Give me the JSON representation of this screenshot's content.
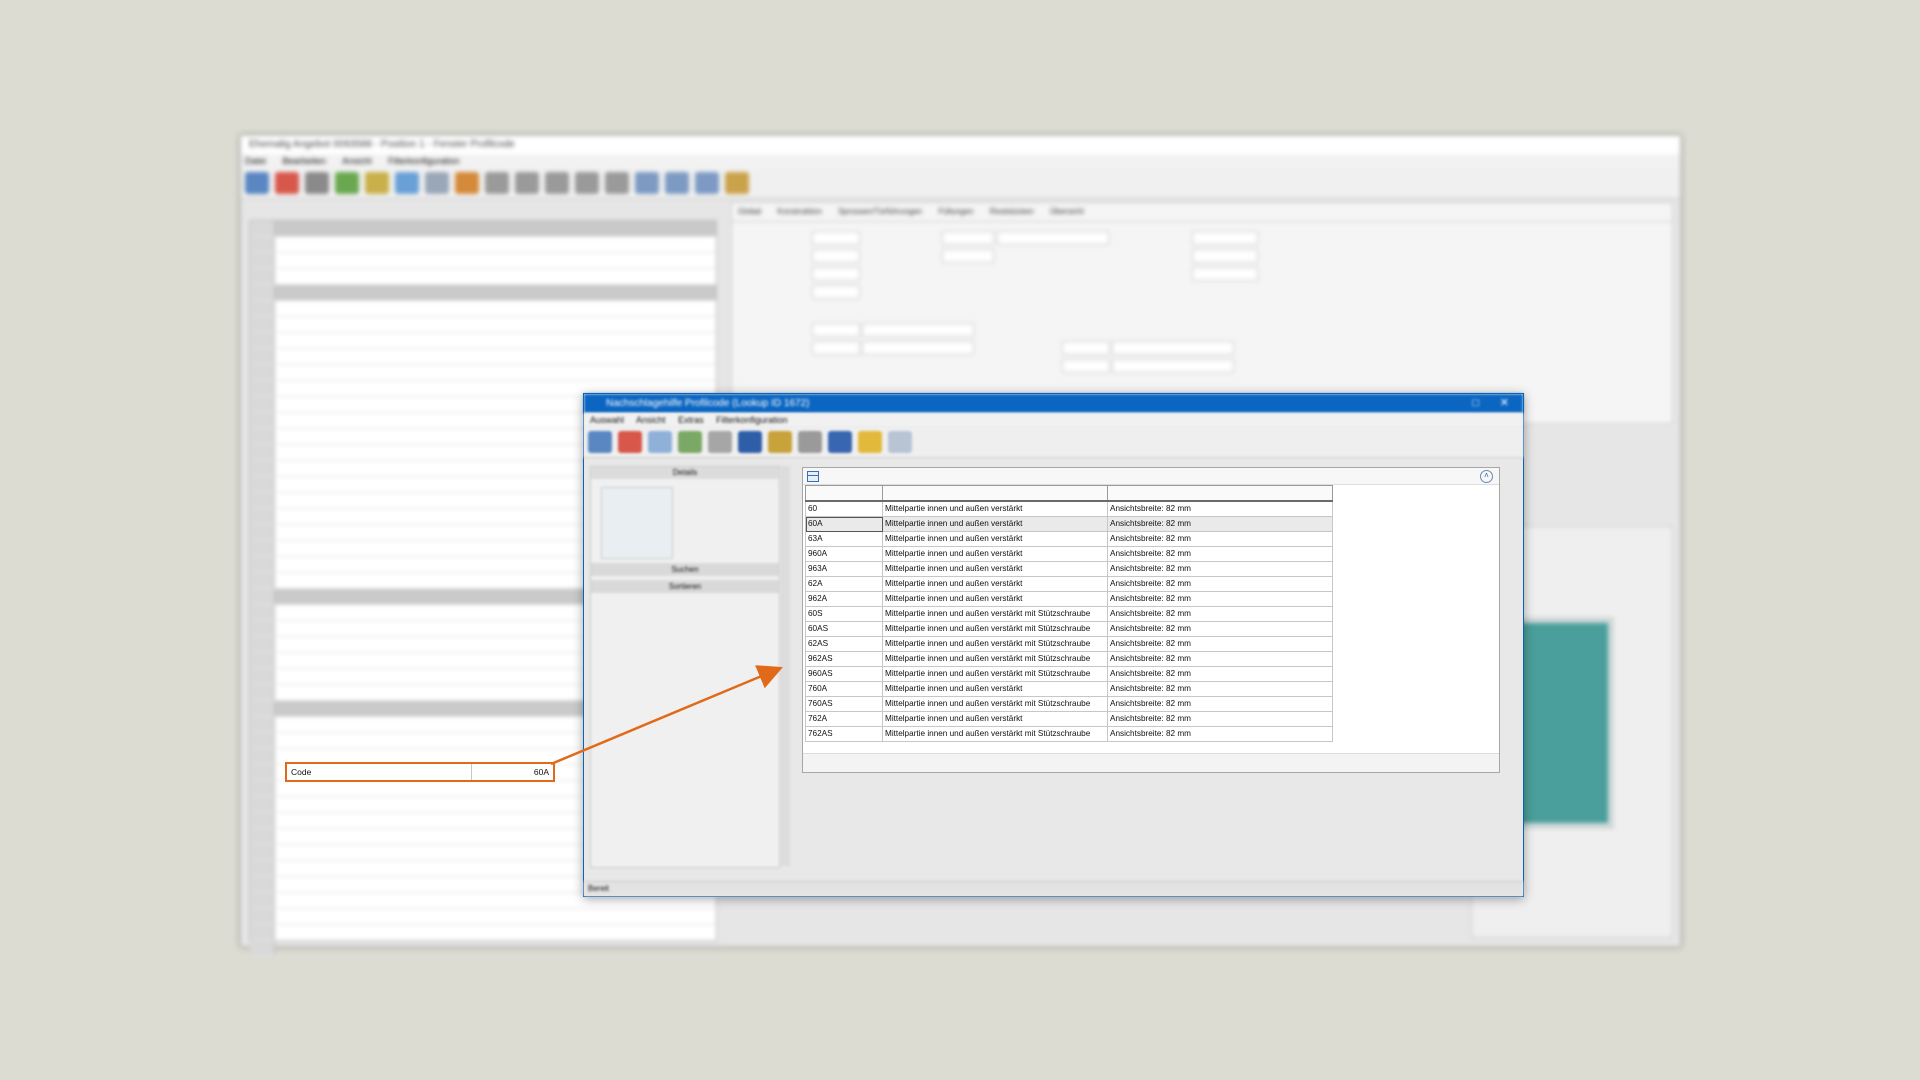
{
  "background_app": {
    "title": "Ehemalig Angebot 0093588 - Position 1 - Fenster Profilcode",
    "menu": [
      "Datei",
      "Bearbeiten",
      "Ansicht",
      "Filterkonfiguration"
    ],
    "tabs": [
      "Global",
      "Konstruktion",
      "Sprossen/Türführungen",
      "Füllungen",
      "Reststücken",
      "Übersicht"
    ]
  },
  "dialog": {
    "title": "Nachschlagehilfe Profilcode (Lookup ID 1672)",
    "menu": [
      "Auswahl",
      "Ansicht",
      "Extras",
      "Filterkonfiguration"
    ],
    "left_header": "Details",
    "actions": [
      "Suchen",
      "Sortieren"
    ],
    "status_left": "Bereit"
  },
  "lookup": {
    "columns": [
      "",
      "",
      ""
    ],
    "rows": [
      {
        "code": "60",
        "description": "Mittelpartie innen und außen verstärkt",
        "info": "Ansichtsbreite: 82 mm"
      },
      {
        "code": "60A",
        "description": "Mittelpartie innen und außen verstärkt",
        "info": "Ansichtsbreite: 82 mm"
      },
      {
        "code": "63A",
        "description": "Mittelpartie innen und außen verstärkt",
        "info": "Ansichtsbreite: 82 mm"
      },
      {
        "code": "960A",
        "description": "Mittelpartie innen und außen verstärkt",
        "info": "Ansichtsbreite: 82 mm"
      },
      {
        "code": "963A",
        "description": "Mittelpartie innen und außen verstärkt",
        "info": "Ansichtsbreite: 82 mm"
      },
      {
        "code": "62A",
        "description": "Mittelpartie innen und außen verstärkt",
        "info": "Ansichtsbreite: 82 mm"
      },
      {
        "code": "962A",
        "description": "Mittelpartie innen und außen verstärkt",
        "info": "Ansichtsbreite: 82 mm"
      },
      {
        "code": "60S",
        "description": "Mittelpartie innen und außen verstärkt mit Stützschraube",
        "info": "Ansichtsbreite: 82 mm"
      },
      {
        "code": "60AS",
        "description": "Mittelpartie innen und außen verstärkt mit Stützschraube",
        "info": "Ansichtsbreite: 82 mm"
      },
      {
        "code": "62AS",
        "description": "Mittelpartie innen und außen verstärkt mit Stützschraube",
        "info": "Ansichtsbreite: 82 mm"
      },
      {
        "code": "962AS",
        "description": "Mittelpartie innen und außen verstärkt mit Stützschraube",
        "info": "Ansichtsbreite: 82 mm"
      },
      {
        "code": "960AS",
        "description": "Mittelpartie innen und außen verstärkt mit Stützschraube",
        "info": "Ansichtsbreite: 82 mm"
      },
      {
        "code": "760A",
        "description": "Mittelpartie innen und außen verstärkt",
        "info": "Ansichtsbreite: 82 mm"
      },
      {
        "code": "760AS",
        "description": "Mittelpartie innen und außen verstärkt mit Stützschraube",
        "info": "Ansichtsbreite: 82 mm"
      },
      {
        "code": "762A",
        "description": "Mittelpartie innen und außen verstärkt",
        "info": "Ansichtsbreite: 82 mm"
      },
      {
        "code": "762AS",
        "description": "Mittelpartie innen und außen verstärkt mit Stützschraube",
        "info": "Ansichtsbreite: 82 mm"
      }
    ],
    "selected_code": "60A"
  },
  "highlight_field": {
    "label": "Code",
    "value": "60A"
  },
  "colors": {
    "accent": "#0b66c2",
    "highlight_orange": "#e06a19",
    "page_background": "#dcdcd2"
  }
}
